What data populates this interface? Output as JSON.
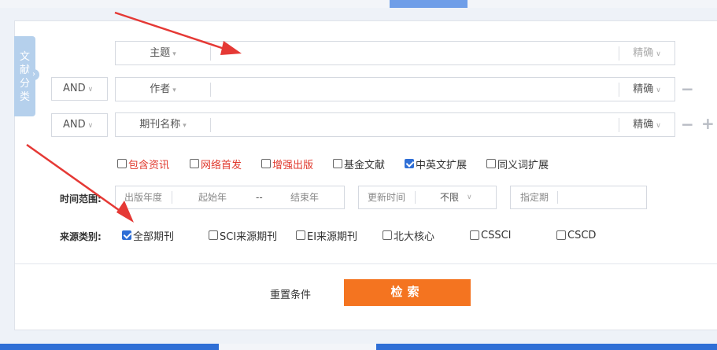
{
  "side_tab": {
    "chars": [
      "文",
      "献",
      "分",
      "类"
    ],
    "handle": "›"
  },
  "rows": [
    {
      "logic": "",
      "field": "主题",
      "match": "精确",
      "match_muted": true,
      "ops": []
    },
    {
      "logic": "AND",
      "field": "作者",
      "match": "精确",
      "match_muted": false,
      "ops": [
        "−"
      ]
    },
    {
      "logic": "AND",
      "field": "期刊名称",
      "match": "精确",
      "match_muted": false,
      "ops": [
        "−",
        "+"
      ]
    }
  ],
  "options": [
    {
      "label": "包含资讯",
      "checked": false,
      "red": true
    },
    {
      "label": "网络首发",
      "checked": false,
      "red": true
    },
    {
      "label": "增强出版",
      "checked": false,
      "red": true
    },
    {
      "label": "基金文献",
      "checked": false,
      "red": false
    },
    {
      "label": "中英文扩展",
      "checked": true,
      "red": false
    },
    {
      "label": "同义词扩展",
      "checked": false,
      "red": false
    }
  ],
  "time": {
    "label": "时间范围:",
    "year_label": "出版年度",
    "start_placeholder": "起始年",
    "dash": "--",
    "end_placeholder": "结束年",
    "update_label": "更新时间",
    "update_value": "不限",
    "period_label": "指定期"
  },
  "source": {
    "label": "来源类别:",
    "items": [
      {
        "label": "全部期刊",
        "checked": true
      },
      {
        "label": "SCI来源期刊",
        "checked": false
      },
      {
        "label": "EI来源期刊",
        "checked": false
      },
      {
        "label": "北大核心",
        "checked": false
      },
      {
        "label": "CSSCI",
        "checked": false
      },
      {
        "label": "CSCD",
        "checked": false
      }
    ]
  },
  "actions": {
    "reset": "重置条件",
    "search": "检索"
  },
  "colors": {
    "accent": "#2f6fd6",
    "search_button": "#f47420",
    "red_text": "#e0392d",
    "arrow": "#e53935"
  }
}
